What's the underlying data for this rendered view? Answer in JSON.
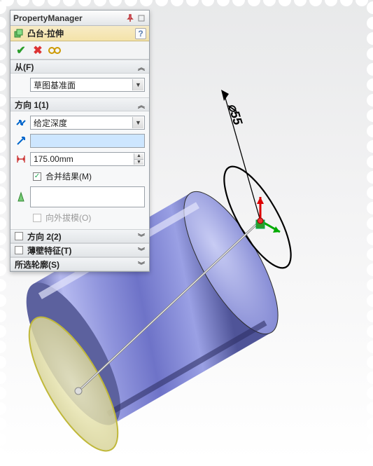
{
  "panel": {
    "title": "PropertyManager",
    "feature_name": "凸台-拉伸",
    "sections": {
      "from": {
        "label": "从(F)",
        "plane": "草图基准面"
      },
      "dir1": {
        "label": "方向 1(1)",
        "end_condition": "给定深度",
        "depth": "175.00mm",
        "merge": "合并结果(M)",
        "draft_out": "向外拔模(O)"
      },
      "dir2": {
        "label": "方向 2(2)"
      },
      "thin": {
        "label": "薄壁特征(T)"
      },
      "contours": {
        "label": "所选轮廓(S)"
      }
    }
  },
  "viewport": {
    "dimension_label": "⌀55"
  }
}
